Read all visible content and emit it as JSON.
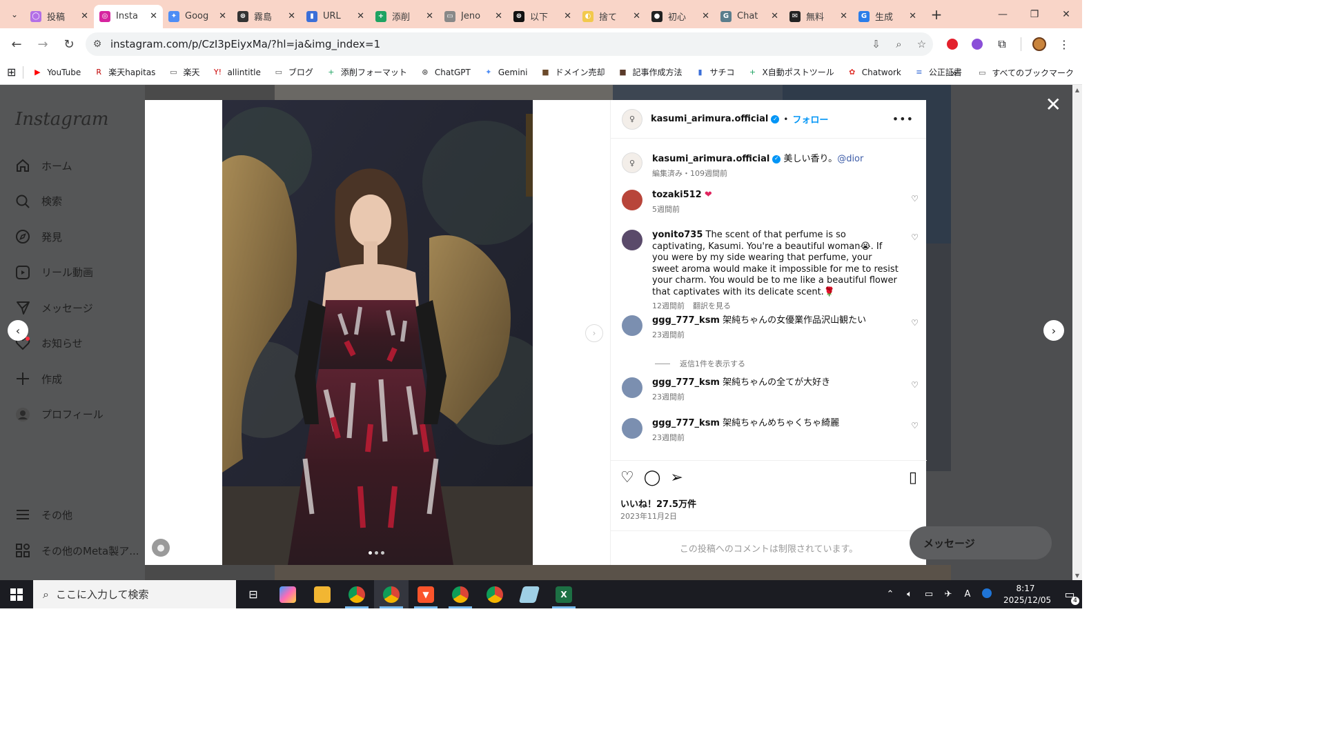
{
  "browser": {
    "tabs": [
      {
        "label": "投稿",
        "color": "#b36fe6",
        "glyph": "◯",
        "active": false
      },
      {
        "label": "Insta",
        "color": "#d6249f",
        "glyph": "◎",
        "active": true
      },
      {
        "label": "Goog",
        "color": "#4e8df5",
        "glyph": "✦",
        "active": false
      },
      {
        "label": "霧島",
        "color": "#333333",
        "glyph": "⊛",
        "active": false
      },
      {
        "label": "URL",
        "color": "#3b6fd8",
        "glyph": "▮",
        "active": false
      },
      {
        "label": "添削",
        "color": "#1ea362",
        "glyph": "+",
        "active": false
      },
      {
        "label": "Jeno",
        "color": "#888888",
        "glyph": "▭",
        "active": false
      },
      {
        "label": "以下",
        "color": "#111111",
        "glyph": "⊛",
        "active": false
      },
      {
        "label": "捨て",
        "color": "#f2c94c",
        "glyph": "◐",
        "active": false
      },
      {
        "label": "初心",
        "color": "#222222",
        "glyph": "●",
        "active": false
      },
      {
        "label": "Chat",
        "color": "#5a7d8c",
        "glyph": "G",
        "active": false
      },
      {
        "label": "無料",
        "color": "#222222",
        "glyph": "✉",
        "active": false
      },
      {
        "label": "生成",
        "color": "#2b7de9",
        "glyph": "G",
        "active": false
      }
    ],
    "url": "instagram.com/p/CzI3pEiyxMa/?hl=ja&img_index=1",
    "bookmarks": [
      {
        "label": "YouTube",
        "glyph": "▶",
        "color": "#ff0000"
      },
      {
        "label": "楽天hapitas",
        "glyph": "R",
        "color": "#bf0000"
      },
      {
        "label": "楽天",
        "glyph": "▭",
        "color": "#555555"
      },
      {
        "label": "allintitle",
        "glyph": "Y!",
        "color": "#cc0000"
      },
      {
        "label": "ブログ",
        "glyph": "▭",
        "color": "#555555"
      },
      {
        "label": "添削フォーマット",
        "glyph": "+",
        "color": "#1ea362"
      },
      {
        "label": "ChatGPT",
        "glyph": "⊛",
        "color": "#333333"
      },
      {
        "label": "Gemini",
        "glyph": "✦",
        "color": "#4e8df5"
      },
      {
        "label": "ドメイン売却",
        "glyph": "■",
        "color": "#6b4a2a"
      },
      {
        "label": "記事作成方法",
        "glyph": "■",
        "color": "#5a3a2a"
      },
      {
        "label": "サチコ",
        "glyph": "▮",
        "color": "#3b6fd8"
      },
      {
        "label": "X自動ポストツール",
        "glyph": "+",
        "color": "#1ea362"
      },
      {
        "label": "Chatwork",
        "glyph": "✿",
        "color": "#e0322c"
      },
      {
        "label": "公正証書",
        "glyph": "≡",
        "color": "#3b6fd8"
      }
    ],
    "all_bookmarks": "すべてのブックマーク"
  },
  "instagram": {
    "logo": "Instagram",
    "nav": [
      {
        "label": "ホーム",
        "icon": "home-icon"
      },
      {
        "label": "検索",
        "icon": "search-icon"
      },
      {
        "label": "発見",
        "icon": "compass-icon"
      },
      {
        "label": "リール動画",
        "icon": "reels-icon"
      },
      {
        "label": "メッセージ",
        "icon": "messenger-icon"
      },
      {
        "label": "お知らせ",
        "icon": "heart-icon"
      },
      {
        "label": "作成",
        "icon": "plus-icon"
      },
      {
        "label": "プロフィール",
        "icon": "profile-icon"
      }
    ],
    "more": "その他",
    "meta": "その他のMeta製ア...",
    "messages_pill": "メッセージ"
  },
  "post": {
    "username": "kasumi_arimura.official",
    "follow": "フォロー",
    "caption_text": "美しい香り。",
    "caption_mention": "@dior",
    "caption_meta": "編集済み・109週間前",
    "comments": [
      {
        "user": "tozaki512",
        "text": "❤",
        "time": "5週間前",
        "translate": ""
      },
      {
        "user": "yonito735",
        "text": "The scent of that perfume is so captivating, Kasumi. You're a beautiful woman😭. If you were by my side wearing that perfume, your sweet aroma would make it impossible for me to resist your charm. You would be to me like a beautiful flower that captivates with its delicate scent.🌹",
        "time": "12週間前",
        "translate": "翻訳を見る"
      },
      {
        "user": "ggg_777_ksm",
        "text": "架純ちゃんの女優業作品沢山観たい",
        "time": "23週間前",
        "translate": ""
      },
      {
        "user": "ggg_777_ksm",
        "text": "架純ちゃんの全てが大好き",
        "time": "23週間前",
        "translate": ""
      },
      {
        "user": "ggg_777_ksm",
        "text": "架純ちゃんめちゃくちゃ綺麗",
        "time": "23週間前",
        "translate": ""
      }
    ],
    "view_replies": "返信1件を表示する",
    "likes": "いいね！27.5万件",
    "date": "2023年11月2日",
    "restricted": "この投稿へのコメントは制限されています。"
  },
  "taskbar": {
    "search_placeholder": "ここに入力して検索",
    "ime": "A",
    "time": "8:17",
    "date": "2025/12/05",
    "notifications": "4"
  }
}
